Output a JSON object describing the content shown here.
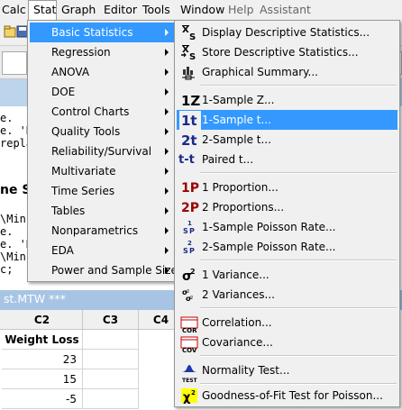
{
  "menubar": {
    "items": [
      "Calc",
      "Stat",
      "Graph",
      "Editor",
      "Tools",
      "Window",
      "Help",
      "Assistant"
    ]
  },
  "session": {
    "lines": [
      "e.",
      "e. 'D:",
      "repla",
      "\\Min",
      "e.",
      "e. 'D:",
      "\\Min",
      "c;"
    ],
    "bold_text": "ne Sa"
  },
  "worksheet": {
    "title": "st.MTW ***",
    "columns": [
      "C2",
      "C3",
      "C4"
    ],
    "column_name": "Weight Loss",
    "values": [
      "23",
      "15",
      "-5"
    ]
  },
  "stat_menu": {
    "items": [
      {
        "label": "Basic Statistics",
        "submenu": true,
        "highlighted": true
      },
      {
        "label": "Regression",
        "submenu": true
      },
      {
        "label": "ANOVA",
        "submenu": true
      },
      {
        "label": "DOE",
        "submenu": true
      },
      {
        "label": "Control Charts",
        "submenu": true
      },
      {
        "label": "Quality Tools",
        "submenu": true
      },
      {
        "label": "Reliability/Survival",
        "submenu": true
      },
      {
        "label": "Multivariate",
        "submenu": true
      },
      {
        "label": "Time Series",
        "submenu": true
      },
      {
        "label": "Tables",
        "submenu": true
      },
      {
        "label": "Nonparametrics",
        "submenu": true
      },
      {
        "label": "EDA",
        "submenu": true
      },
      {
        "label": "Power and Sample Size",
        "submenu": true
      }
    ]
  },
  "basic_stats_menu": {
    "items": [
      {
        "label": "Display Descriptive Statistics...",
        "icon": "xbar-s-icon"
      },
      {
        "label": "Store Descriptive Statistics...",
        "icon": "xbar-s-store-icon"
      },
      {
        "label": "Graphical Summary...",
        "icon": "graphical-summary-icon"
      },
      {
        "label": "1-Sample Z...",
        "icon_text": "1Z"
      },
      {
        "label": "1-Sample t...",
        "icon_text": "1t",
        "highlighted": true
      },
      {
        "label": "2-Sample t...",
        "icon_text": "2t"
      },
      {
        "label": "Paired t...",
        "icon_text": "t-t"
      },
      {
        "label": "1 Proportion...",
        "icon_text": "1P"
      },
      {
        "label": "2 Proportions...",
        "icon_text": "2P"
      },
      {
        "label": "1-Sample Poisson Rate...",
        "icon": "poisson-1-icon"
      },
      {
        "label": "2-Sample Poisson Rate...",
        "icon": "poisson-2-icon"
      },
      {
        "label": "1 Variance...",
        "icon": "sigma-squared-icon"
      },
      {
        "label": "2 Variances...",
        "icon": "two-sigma-squared-icon"
      },
      {
        "label": "Correlation...",
        "icon_text": "COR"
      },
      {
        "label": "Covariance...",
        "icon_text": "COV"
      },
      {
        "label": "Normality Test...",
        "icon": "normality-test-icon",
        "icon_text": "TEST"
      },
      {
        "label": "Goodness-of-Fit Test for Poisson...",
        "icon": "chi-squared-icon"
      }
    ]
  },
  "colors": {
    "highlight": "#3399ff",
    "menu_bg": "#f0f0f0",
    "red_icon": "#cc0000",
    "blue_icon": "#1a2a8a"
  }
}
